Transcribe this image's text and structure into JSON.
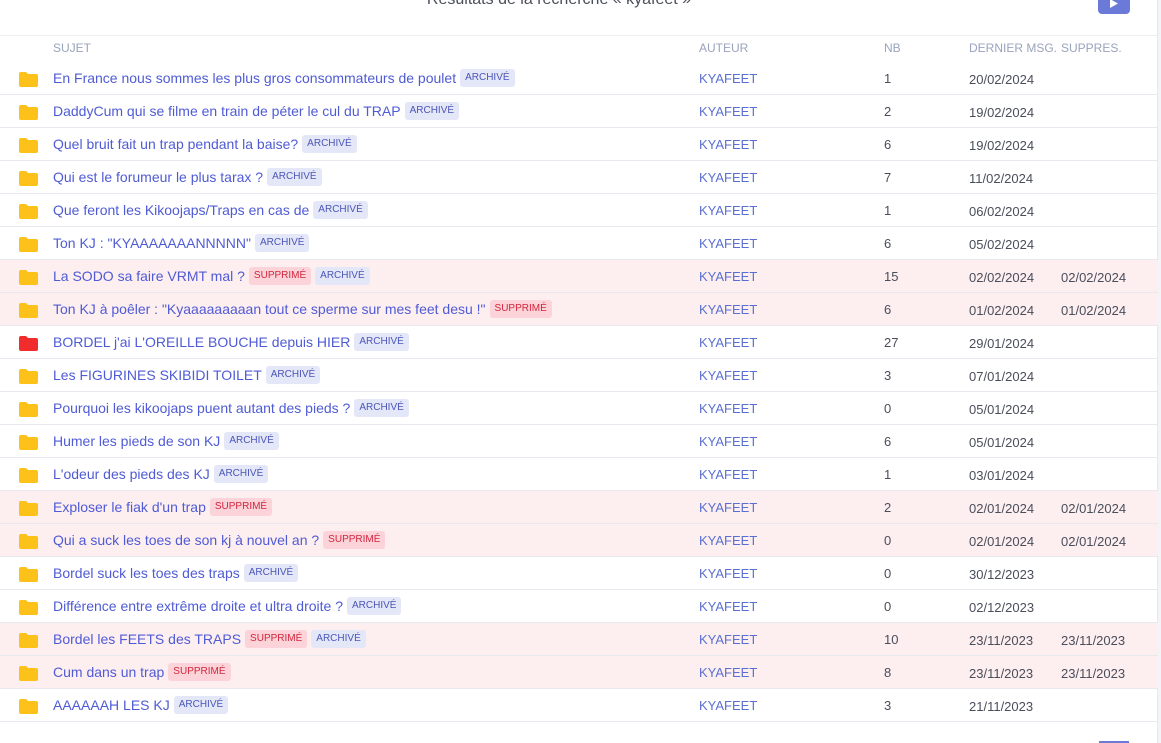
{
  "header": {
    "title": "Résultats de la recherche « kyafeet »"
  },
  "columns": {
    "subject": "SUJET",
    "author": "AUTEUR",
    "nb": "NB",
    "last": "DERNIER MSG.",
    "deleted": "SUPPRES."
  },
  "colors": {
    "folder_default": "#fcc21a",
    "folder_hot": "#f02c2c",
    "link": "#4f5bd5",
    "deleted_row_bg": "#fdeef0"
  },
  "rows": [
    {
      "subject": "En France nous sommes les plus gros consommateurs de poulet",
      "badges": [
        "ARCHIVÉ"
      ],
      "author": "KYAFEET",
      "nb": "1",
      "last": "20/02/2024",
      "deleted_date": "",
      "folder": "folder-icon"
    },
    {
      "subject": "DaddyCum qui se filme en train de péter le cul du TRAP",
      "badges": [
        "ARCHIVÉ"
      ],
      "author": "KYAFEET",
      "nb": "2",
      "last": "19/02/2024",
      "deleted_date": "",
      "folder": "folder-icon"
    },
    {
      "subject": "Quel bruit fait un trap pendant la baise?",
      "badges": [
        "ARCHIVÉ"
      ],
      "author": "KYAFEET",
      "nb": "6",
      "last": "19/02/2024",
      "deleted_date": "",
      "folder": "folder-icon"
    },
    {
      "subject": "Qui est le forumeur le plus tarax ?",
      "badges": [
        "ARCHIVÉ"
      ],
      "author": "KYAFEET",
      "nb": "7",
      "last": "11/02/2024",
      "deleted_date": "",
      "folder": "folder-icon"
    },
    {
      "subject": "Que feront les Kikoojaps/Traps en cas de",
      "badges": [
        "ARCHIVÉ"
      ],
      "author": "KYAFEET",
      "nb": "1",
      "last": "06/02/2024",
      "deleted_date": "",
      "folder": "folder-icon"
    },
    {
      "subject": "Ton KJ : \"KYAAAAAAANNNNN\"",
      "badges": [
        "ARCHIVÉ"
      ],
      "author": "KYAFEET",
      "nb": "6",
      "last": "05/02/2024",
      "deleted_date": "",
      "folder": "folder-icon"
    },
    {
      "subject": "La SODO sa faire VRMT mal ?",
      "badges": [
        "SUPPRIMÉ",
        "ARCHIVÉ"
      ],
      "author": "KYAFEET",
      "nb": "15",
      "last": "02/02/2024",
      "deleted_date": "02/02/2024",
      "folder": "folder-icon"
    },
    {
      "subject": "Ton KJ à poêler : \"Kyaaaaaaaaan tout ce sperme sur mes feet desu !\"",
      "badges": [
        "SUPPRIMÉ"
      ],
      "author": "KYAFEET",
      "nb": "6",
      "last": "01/02/2024",
      "deleted_date": "01/02/2024",
      "folder": "folder-icon"
    },
    {
      "subject": "BORDEL j'ai L'OREILLE BOUCHE depuis HIER",
      "badges": [
        "ARCHIVÉ"
      ],
      "author": "KYAFEET",
      "nb": "27",
      "last": "29/01/2024",
      "deleted_date": "",
      "folder": "hot-folder-icon"
    },
    {
      "subject": "Les FIGURINES SKIBIDI TOILET",
      "badges": [
        "ARCHIVÉ"
      ],
      "author": "KYAFEET",
      "nb": "3",
      "last": "07/01/2024",
      "deleted_date": "",
      "folder": "folder-icon"
    },
    {
      "subject": "Pourquoi les kikoojaps puent autant des pieds ?",
      "badges": [
        "ARCHIVÉ"
      ],
      "author": "KYAFEET",
      "nb": "0",
      "last": "05/01/2024",
      "deleted_date": "",
      "folder": "folder-icon"
    },
    {
      "subject": "Humer les pieds de son KJ",
      "badges": [
        "ARCHIVÉ"
      ],
      "author": "KYAFEET",
      "nb": "6",
      "last": "05/01/2024",
      "deleted_date": "",
      "folder": "folder-icon"
    },
    {
      "subject": "L'odeur des pieds des KJ",
      "badges": [
        "ARCHIVÉ"
      ],
      "author": "KYAFEET",
      "nb": "1",
      "last": "03/01/2024",
      "deleted_date": "",
      "folder": "folder-icon"
    },
    {
      "subject": "Exploser le fiak d'un trap",
      "badges": [
        "SUPPRIMÉ"
      ],
      "author": "KYAFEET",
      "nb": "2",
      "last": "02/01/2024",
      "deleted_date": "02/01/2024",
      "folder": "folder-icon"
    },
    {
      "subject": "Qui a suck les toes de son kj à nouvel an ?",
      "badges": [
        "SUPPRIMÉ"
      ],
      "author": "KYAFEET",
      "nb": "0",
      "last": "02/01/2024",
      "deleted_date": "02/01/2024",
      "folder": "folder-icon"
    },
    {
      "subject": "Bordel suck les toes des traps",
      "badges": [
        "ARCHIVÉ"
      ],
      "author": "KYAFEET",
      "nb": "0",
      "last": "30/12/2023",
      "deleted_date": "",
      "folder": "folder-icon"
    },
    {
      "subject": "Différence entre extrême droite et ultra droite ?",
      "badges": [
        "ARCHIVÉ"
      ],
      "author": "KYAFEET",
      "nb": "0",
      "last": "02/12/2023",
      "deleted_date": "",
      "folder": "folder-icon"
    },
    {
      "subject": "Bordel les FEETS des TRAPS",
      "badges": [
        "SUPPRIMÉ",
        "ARCHIVÉ"
      ],
      "author": "KYAFEET",
      "nb": "10",
      "last": "23/11/2023",
      "deleted_date": "23/11/2023",
      "folder": "folder-icon"
    },
    {
      "subject": "Cum dans un trap",
      "badges": [
        "SUPPRIMÉ"
      ],
      "author": "KYAFEET",
      "nb": "8",
      "last": "23/11/2023",
      "deleted_date": "23/11/2023",
      "folder": "folder-icon"
    },
    {
      "subject": "AAAAAAH LES KJ",
      "badges": [
        "ARCHIVÉ"
      ],
      "author": "KYAFEET",
      "nb": "3",
      "last": "21/11/2023",
      "deleted_date": "",
      "folder": "folder-icon"
    }
  ]
}
